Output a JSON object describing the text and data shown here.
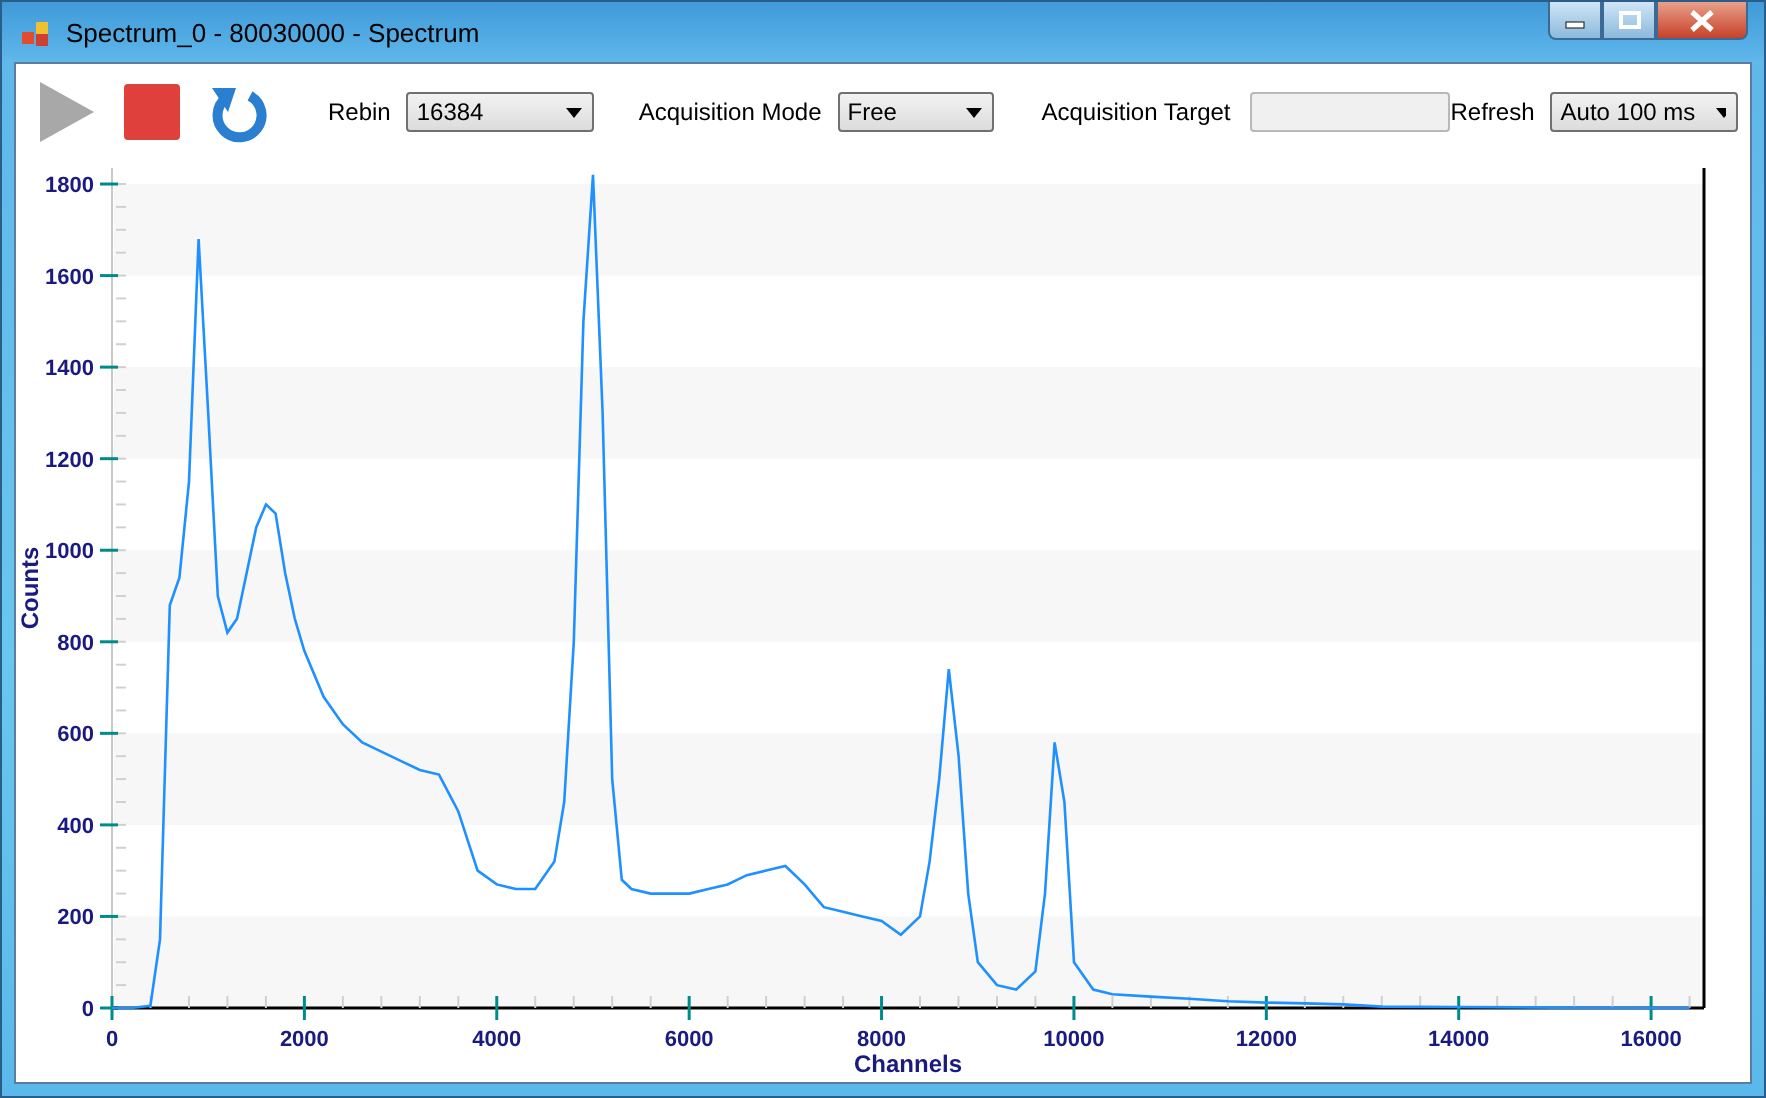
{
  "window": {
    "title": "Spectrum_0 - 80030000 - Spectrum"
  },
  "toolbar": {
    "transport": [
      {
        "kind": "play",
        "disabled": true
      },
      {
        "kind": "stop",
        "disabled": false
      },
      {
        "kind": "reset",
        "disabled": false
      }
    ],
    "fields": [
      {
        "kind": "dropdown",
        "label": "Rebin",
        "value": "16384"
      },
      {
        "kind": "dropdown",
        "label": "Acquisition Mode",
        "value": "Free"
      },
      {
        "kind": "text",
        "label": "Acquisition Target",
        "disabled": true
      },
      {
        "kind": "dropdown",
        "label": "Refresh",
        "value": "Auto 100 ms"
      }
    ]
  },
  "chart": {
    "chart_data": {
      "type": "line",
      "xlabel": "Channels",
      "ylabel": "Counts",
      "xlim": [
        0,
        16550
      ],
      "ylim": [
        0,
        1835
      ],
      "xticks": [
        0,
        2000,
        4000,
        6000,
        8000,
        10000,
        12000,
        14000,
        16000
      ],
      "yticks": [
        0,
        200,
        400,
        600,
        800,
        1000,
        1200,
        1400,
        1600,
        1800
      ],
      "x": [
        0,
        200,
        400,
        500,
        600,
        700,
        800,
        900,
        1000,
        1100,
        1200,
        1300,
        1400,
        1500,
        1600,
        1700,
        1800,
        1900,
        2000,
        2200,
        2400,
        2600,
        2800,
        3000,
        3200,
        3400,
        3600,
        3800,
        4000,
        4200,
        4400,
        4600,
        4700,
        4800,
        4900,
        5000,
        5100,
        5200,
        5300,
        5400,
        5600,
        5800,
        6000,
        6200,
        6400,
        6600,
        6800,
        7000,
        7200,
        7400,
        7600,
        7800,
        8000,
        8200,
        8400,
        8500,
        8600,
        8700,
        8800,
        8900,
        9000,
        9200,
        9400,
        9600,
        9700,
        9800,
        9900,
        10000,
        10200,
        10400,
        10800,
        11200,
        11600,
        12000,
        12400,
        12800,
        13200,
        14000,
        15000,
        16000,
        16400
      ],
      "series": [
        {
          "color": "#1e90ff",
          "values": [
            0,
            0,
            5,
            150,
            880,
            940,
            1150,
            1680,
            1300,
            900,
            820,
            850,
            950,
            1050,
            1100,
            1080,
            950,
            850,
            780,
            680,
            620,
            580,
            560,
            540,
            520,
            510,
            430,
            300,
            270,
            260,
            260,
            320,
            450,
            800,
            1500,
            1820,
            1300,
            500,
            280,
            260,
            250,
            250,
            250,
            260,
            270,
            290,
            300,
            310,
            270,
            220,
            210,
            200,
            190,
            160,
            200,
            320,
            500,
            740,
            550,
            250,
            100,
            50,
            40,
            80,
            250,
            580,
            450,
            100,
            40,
            30,
            25,
            20,
            15,
            12,
            10,
            8,
            3,
            2,
            1,
            0,
            0
          ]
        }
      ]
    }
  }
}
